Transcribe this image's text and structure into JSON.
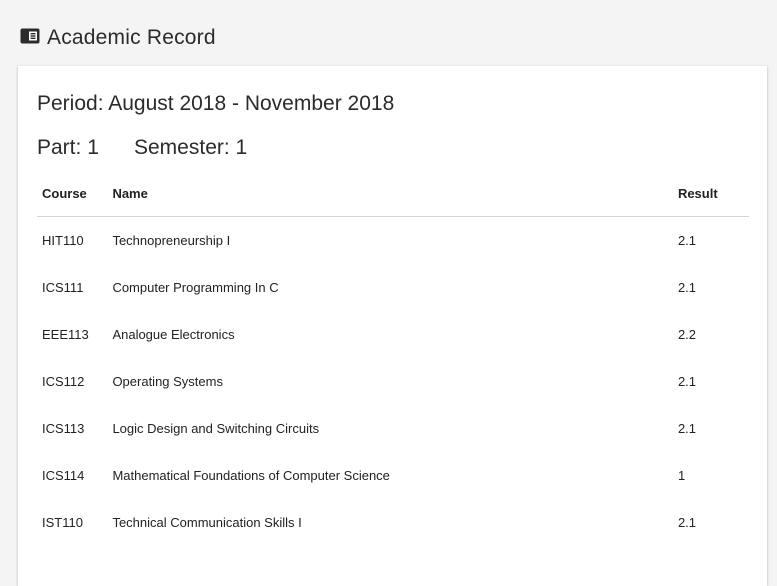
{
  "header": {
    "icon": "id-card-icon",
    "title": "Academic Record"
  },
  "record": {
    "period_label": "Period:",
    "period_value": "August 2018 - November 2018",
    "part_label": "Part:",
    "part_value": "1",
    "semester_label": "Semester:",
    "semester_value": "1",
    "columns": {
      "course": "Course",
      "name": "Name",
      "result": "Result"
    },
    "rows": [
      {
        "course": "HIT110",
        "name": "Technopreneurship I",
        "result": "2.1"
      },
      {
        "course": "ICS111",
        "name": "Computer Programming In C",
        "result": "2.1"
      },
      {
        "course": "EEE113",
        "name": "Analogue Electronics",
        "result": "2.2"
      },
      {
        "course": "ICS112",
        "name": "Operating Systems",
        "result": "2.1"
      },
      {
        "course": "ICS113",
        "name": "Logic Design and Switching Circuits",
        "result": "2.1"
      },
      {
        "course": "ICS114",
        "name": "Mathematical Foundations of Computer Science",
        "result": "1"
      },
      {
        "course": "IST110",
        "name": "Technical Communication Skills I",
        "result": "2.1"
      }
    ]
  },
  "colors": {
    "background": "#f4f4f4",
    "card": "#ffffff",
    "divider": "#d4d4d4",
    "text": "#222222"
  }
}
